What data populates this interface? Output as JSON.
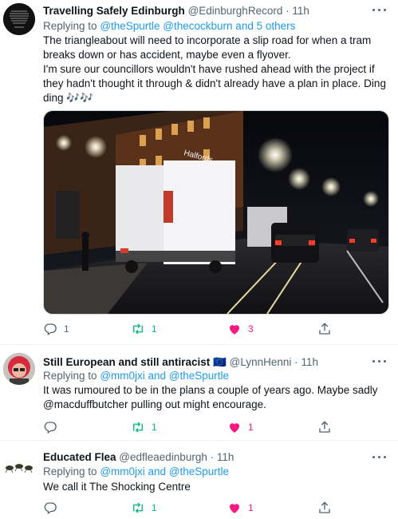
{
  "tweets": [
    {
      "name": "Travelling Safely Edinburgh",
      "handle": "@EdinburghRecord",
      "dot": "·",
      "time": "11h",
      "reply_prefix": "Replying to",
      "reply_to": "@theSpurtle @thecockburn and 5 others",
      "body_p1": "The triangleabout will need to incorporate a slip road for when a tram breaks down or has accident, maybe even a flyover.",
      "body_p2": "I'm sure our councillors wouldn't have rushed ahead with the project if they hadn't thought it through & didn't already have a plan in place. Ding ding 🎶🎶",
      "replies": "1",
      "retweets": "1",
      "likes": "3",
      "media_sign": "Halfords"
    },
    {
      "name": "Still European and still antiracist",
      "flag": "🇪🇺",
      "handle": "@LynnHenni",
      "dot": "·",
      "time": "11h",
      "reply_prefix": "Replying to",
      "reply_to": "@mm0jxi and @theSpurtle",
      "body": "It was rumoured to be in the plans a couple of years ago. Maybe sadly @macduffbutcher pulling out might encourage.",
      "replies": "",
      "retweets": "1",
      "likes": "1"
    },
    {
      "name": "Educated Flea",
      "handle": "@edfleaedinburgh",
      "dot": "·",
      "time": "11h",
      "reply_prefix": "Replying to",
      "reply_to": "@mm0jxi and @theSpurtle",
      "body": "We call it The Shocking Centre",
      "replies": "",
      "retweets": "1",
      "likes": "1"
    }
  ],
  "colors": {
    "like": "#f91880",
    "retweet": "#00ba7c",
    "link": "#1d9bf0",
    "muted": "#536471"
  }
}
